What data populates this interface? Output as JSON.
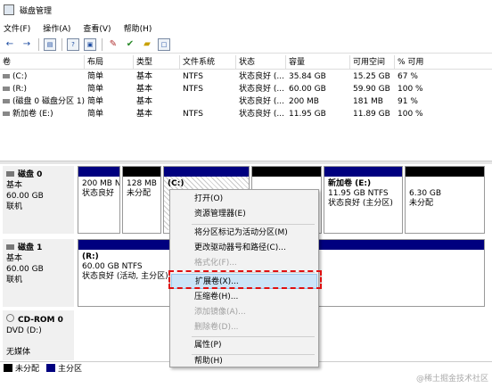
{
  "window": {
    "title": "磁盘管理"
  },
  "menu": [
    "文件(F)",
    "操作(A)",
    "查看(V)",
    "帮助(H)"
  ],
  "toolbar": {
    "back": "←",
    "forward": "→",
    "icons": [
      "properties-icon",
      "help-icon",
      "console-icon",
      "settings-icon",
      "check-icon",
      "folder-icon",
      "window-icon"
    ]
  },
  "volumes": {
    "headers": [
      "卷",
      "布局",
      "类型",
      "文件系统",
      "状态",
      "容量",
      "可用空间",
      "% 可用"
    ],
    "rows": [
      [
        "(C:)",
        "简单",
        "基本",
        "NTFS",
        "状态良好 (...",
        "35.84 GB",
        "15.25 GB",
        "67 %"
      ],
      [
        "(R:)",
        "简单",
        "基本",
        "NTFS",
        "状态良好 (...",
        "60.00 GB",
        "59.90 GB",
        "100 %"
      ],
      [
        "(磁盘 0 磁盘分区 1)",
        "简单",
        "基本",
        "",
        "状态良好 (...",
        "200 MB",
        "181 MB",
        "91 %"
      ],
      [
        "新加卷 (E:)",
        "简单",
        "基本",
        "NTFS",
        "状态良好 (...",
        "11.95 GB",
        "11.89 GB",
        "100 %"
      ]
    ]
  },
  "disks": [
    {
      "name": "磁盘 0",
      "type": "基本",
      "size": "60.00 GB",
      "status": "联机",
      "partitions": [
        {
          "title": "",
          "line1": "200 MB NT",
          "line2": "状态良好"
        },
        {
          "title": "",
          "line1": "128 MB",
          "line2": "未分配"
        },
        {
          "title": "(C:)",
          "line1": "",
          "line2": ""
        },
        {
          "title": "",
          "line1": "",
          "line2": ""
        },
        {
          "title": "新加卷 (E:)",
          "line1": "11.95 GB NTFS",
          "line2": "状态良好 (主分区)"
        },
        {
          "title": "",
          "line1": "6.30 GB",
          "line2": "未分配"
        }
      ]
    },
    {
      "name": "磁盘 1",
      "type": "基本",
      "size": "60.00 GB",
      "status": "联机",
      "partitions": [
        {
          "title": "(R:)",
          "line1": "60.00 GB NTFS",
          "line2": "状态良好 (活动, 主分区)"
        }
      ]
    },
    {
      "name": "CD-ROM 0",
      "type": "DVD (D:)",
      "size": "",
      "status": "无媒体"
    }
  ],
  "context_menu": {
    "items": [
      {
        "label": "打开(O)",
        "enabled": true
      },
      {
        "label": "资源管理器(E)",
        "enabled": true
      },
      {
        "label": "将分区标记为活动分区(M)",
        "enabled": true
      },
      {
        "label": "更改驱动器号和路径(C)...",
        "enabled": true
      },
      {
        "label": "格式化(F)...",
        "enabled": false
      },
      {
        "label": "扩展卷(X)...",
        "enabled": true,
        "highlighted": true
      },
      {
        "label": "压缩卷(H)...",
        "enabled": true
      },
      {
        "label": "添加镜像(A)...",
        "enabled": false
      },
      {
        "label": "删除卷(D)...",
        "enabled": false
      },
      {
        "label": "属性(P)",
        "enabled": true
      },
      {
        "label": "帮助(H)",
        "enabled": true
      }
    ]
  },
  "legend": [
    {
      "label": "未分配",
      "color": "#000000"
    },
    {
      "label": "主分区",
      "color": "#00007f"
    }
  ],
  "watermark": "@稀土掘金技术社区"
}
